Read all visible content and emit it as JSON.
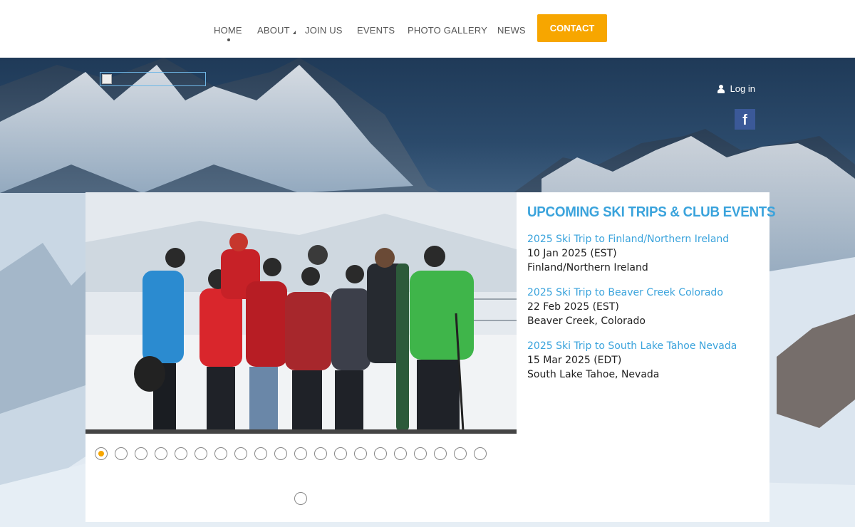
{
  "nav": {
    "items": [
      {
        "label": "HOME"
      },
      {
        "label": "ABOUT"
      },
      {
        "label": "JOIN US"
      },
      {
        "label": "EVENTS"
      },
      {
        "label": "PHOTO GALLERY"
      },
      {
        "label": "NEWS"
      }
    ],
    "contact_label": "CONTACT",
    "accent_color": "#f7a600"
  },
  "header": {
    "login_label": "Log in",
    "facebook_icon": "f"
  },
  "slideshow": {
    "dot_count": 21,
    "active_index": 0
  },
  "events_panel": {
    "heading": "UPCOMING SKI TRIPS & CLUB EVENTS",
    "heading_color": "#3aa3dc",
    "events": [
      {
        "title": "2025 Ski Trip to Finland/Northern Ireland",
        "date": "10 Jan 2025 (EST)",
        "place": "Finland/Northern Ireland"
      },
      {
        "title": "2025 Ski Trip to Beaver Creek Colorado",
        "date": "22 Feb 2025 (EST)",
        "place": "Beaver Creek, Colorado"
      },
      {
        "title": "2025 Ski Trip to South Lake Tahoe Nevada",
        "date": "15 Mar 2025 (EDT)",
        "place": "South Lake Tahoe, Nevada"
      }
    ]
  }
}
